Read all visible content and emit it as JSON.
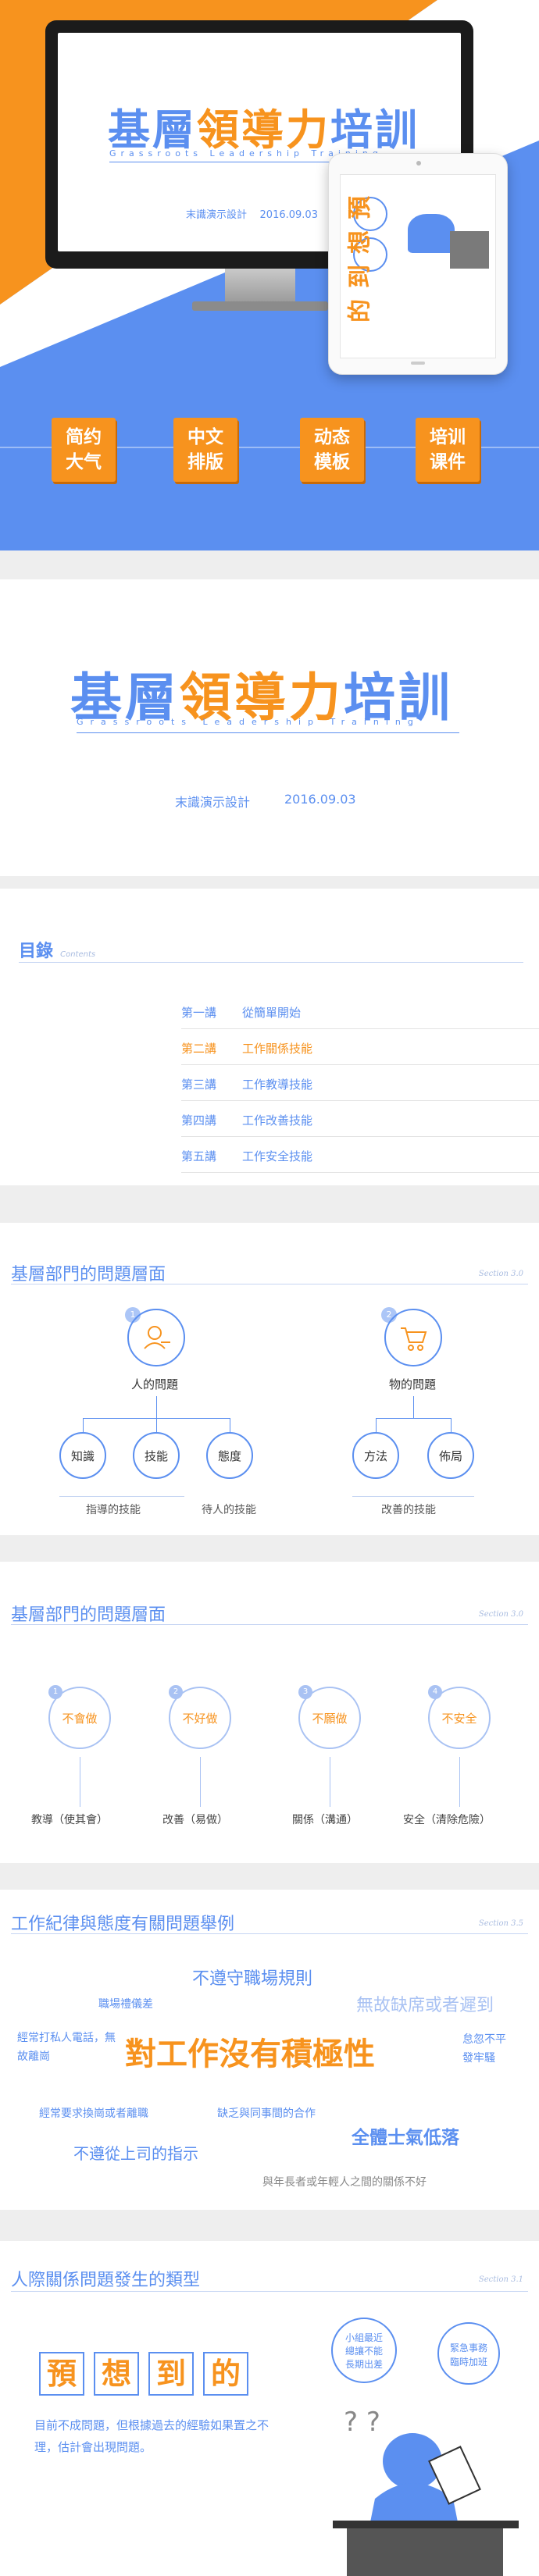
{
  "hero": {
    "title": "基層領導力培訓",
    "subtitle": "Grassroots Leadership Training",
    "meta": "末識演示設計    2016.09.03",
    "tags": [
      "简约\n大气",
      "中文\n排版",
      "动态\n模板",
      "培训\n课件"
    ],
    "tablet_text": "預想到的"
  },
  "cover": {
    "title_part1": "基層",
    "title_part2": "領導力",
    "title_part3": "培訓",
    "subtitle": "Grassroots Leadership Training",
    "author": "末識演示設計",
    "date": "2016.09.03"
  },
  "toc": {
    "title": "目錄",
    "title_en": "Contents",
    "items": [
      {
        "num": "第一講",
        "label": "從簡單開始"
      },
      {
        "num": "第二講",
        "label": "工作關係技能"
      },
      {
        "num": "第三講",
        "label": "工作教導技能"
      },
      {
        "num": "第四講",
        "label": "工作改善技能"
      },
      {
        "num": "第五講",
        "label": "工作安全技能"
      }
    ],
    "active_index": 1
  },
  "slide4": {
    "title": "基層部門的問題層面",
    "tag": "Section 3.0",
    "people_num": "1",
    "people_label": "人的問題",
    "people_children": [
      "知識",
      "技能",
      "態度"
    ],
    "people_notes": [
      "指導的技能",
      "待人的技能"
    ],
    "things_num": "2",
    "things_label": "物的問題",
    "things_children": [
      "方法",
      "佈局"
    ],
    "things_notes": [
      "改善的技能"
    ]
  },
  "slide5": {
    "title": "基層部門的問題層面",
    "tag": "Section 3.0",
    "items": [
      {
        "num": "1",
        "label": "不會做",
        "bottom": "教導（使其會）"
      },
      {
        "num": "2",
        "label": "不好做",
        "bottom": "改善（易做）"
      },
      {
        "num": "3",
        "label": "不願做",
        "bottom": "關係（溝通）"
      },
      {
        "num": "4",
        "label": "不安全",
        "bottom": "安全（清除危險）"
      }
    ]
  },
  "slide6": {
    "title": "工作紀律與態度有關問題舉例",
    "tag": "Section 3.5",
    "words": [
      "不遵守職場規則",
      "職場禮儀差",
      "無故缺席或者遲到",
      "經常打私人電話，無故離崗",
      "對工作沒有積極性",
      "怠忽不平\n發牢騷",
      "經常要求換崗或者離職",
      "缺乏與同事間的合作",
      "全體士氣低落",
      "不遵從上司的指示",
      "與年長者或年輕人之間的關係不好"
    ]
  },
  "slide7": {
    "title": "人際關係問題發生的類型",
    "tag": "Section 3.1",
    "chars": [
      "預",
      "想",
      "到",
      "的"
    ],
    "desc": "目前不成問題，但根據過去的經驗如果置之不理，估計會出現問題。",
    "bubble1": "小組最近\n總讓不能\n長期出差",
    "bubble2": "緊急事務\n臨時加班",
    "question_marks": "? ?"
  },
  "colors": {
    "blue": "#5b8ff0",
    "orange": "#f7931e"
  }
}
